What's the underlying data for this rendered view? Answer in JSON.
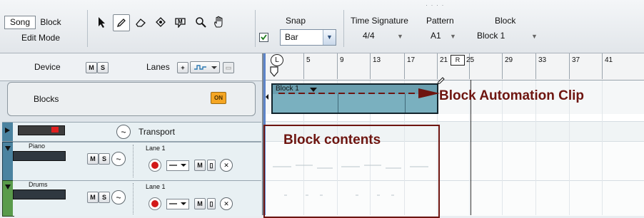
{
  "toolbar": {
    "song_label": "Song",
    "block_label": "Block",
    "edit_mode_label": "Edit Mode",
    "snap_label": "Snap",
    "snap_value": "Bar",
    "time_sig_label": "Time Signature",
    "time_sig_value": "4/4",
    "pattern_label": "Pattern",
    "pattern_value": "A1",
    "block_header": "Block",
    "block_value": "Block 1"
  },
  "left_panel": {
    "device_label": "Device",
    "m_label": "M",
    "s_label": "S",
    "lanes_label": "Lanes",
    "blocks_label": "Blocks",
    "on_label": "ON",
    "transport_label": "Transport",
    "tracks": [
      {
        "name": "Piano",
        "lane": "Lane 1"
      },
      {
        "name": "Drums",
        "lane": "Lane 1"
      }
    ]
  },
  "ruler": {
    "bars": [
      "L",
      "5",
      "9",
      "13",
      "17",
      "21",
      "R",
      "25",
      "29",
      "33",
      "37",
      "41"
    ]
  },
  "clip": {
    "name": "Block 1"
  },
  "annotations": {
    "automation": "Block Automation Clip",
    "contents": "Block contents"
  },
  "colors": {
    "clip": "#7ab0bf",
    "annotation": "#6e1510",
    "record": "#d21818",
    "on_button": "#f5a623"
  }
}
